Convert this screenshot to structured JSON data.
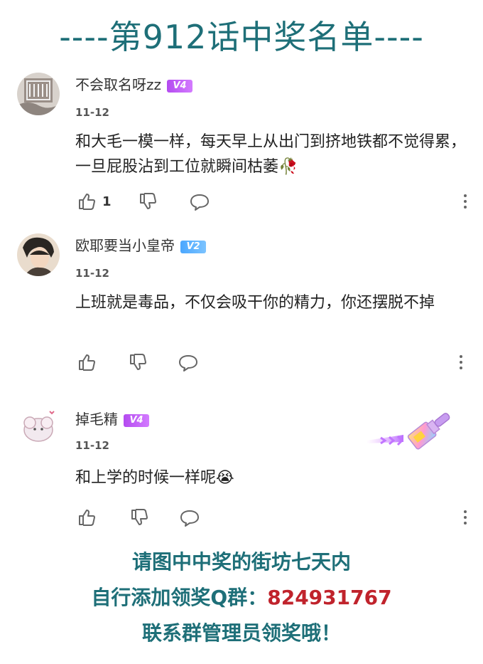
{
  "header": {
    "title": "----第912话中奖名单----"
  },
  "comments": [
    {
      "username": "不会取名呀zz",
      "level": "V4",
      "date": "11-12",
      "text": "和大毛一模一样，每天早上从出门到挤地铁都不觉得累，一旦屁股沾到工位就瞬间枯萎🥀",
      "like_count": "1"
    },
    {
      "username": "欧耶要当小皇帝",
      "level": "V2",
      "date": "11-12",
      "text": "上班就是毒品，不仅会吸干你的精力，你还摆脱不掉",
      "like_count": ""
    },
    {
      "username": "掉毛精",
      "level": "V4",
      "date": "11-12",
      "text": "和上学的时候一样呢😭",
      "like_count": ""
    }
  ],
  "footer": {
    "line1": "请图中中奖的街坊七天内",
    "line2_prefix": "自行添加领奖Q群：",
    "line2_number": "824931767",
    "line3": "联系群管理员领奖哦！"
  },
  "icons": {
    "like": "thumb-up-icon",
    "dislike": "thumb-down-icon",
    "reply": "comment-bubble-icon",
    "more": "more-vertical-icon",
    "decoration": "paint-brush-icon"
  },
  "colors": {
    "title": "#1e6f78",
    "qq_number": "#c0232c",
    "badge_v4": "#b44bf0",
    "badge_v2": "#4aa7ff"
  }
}
